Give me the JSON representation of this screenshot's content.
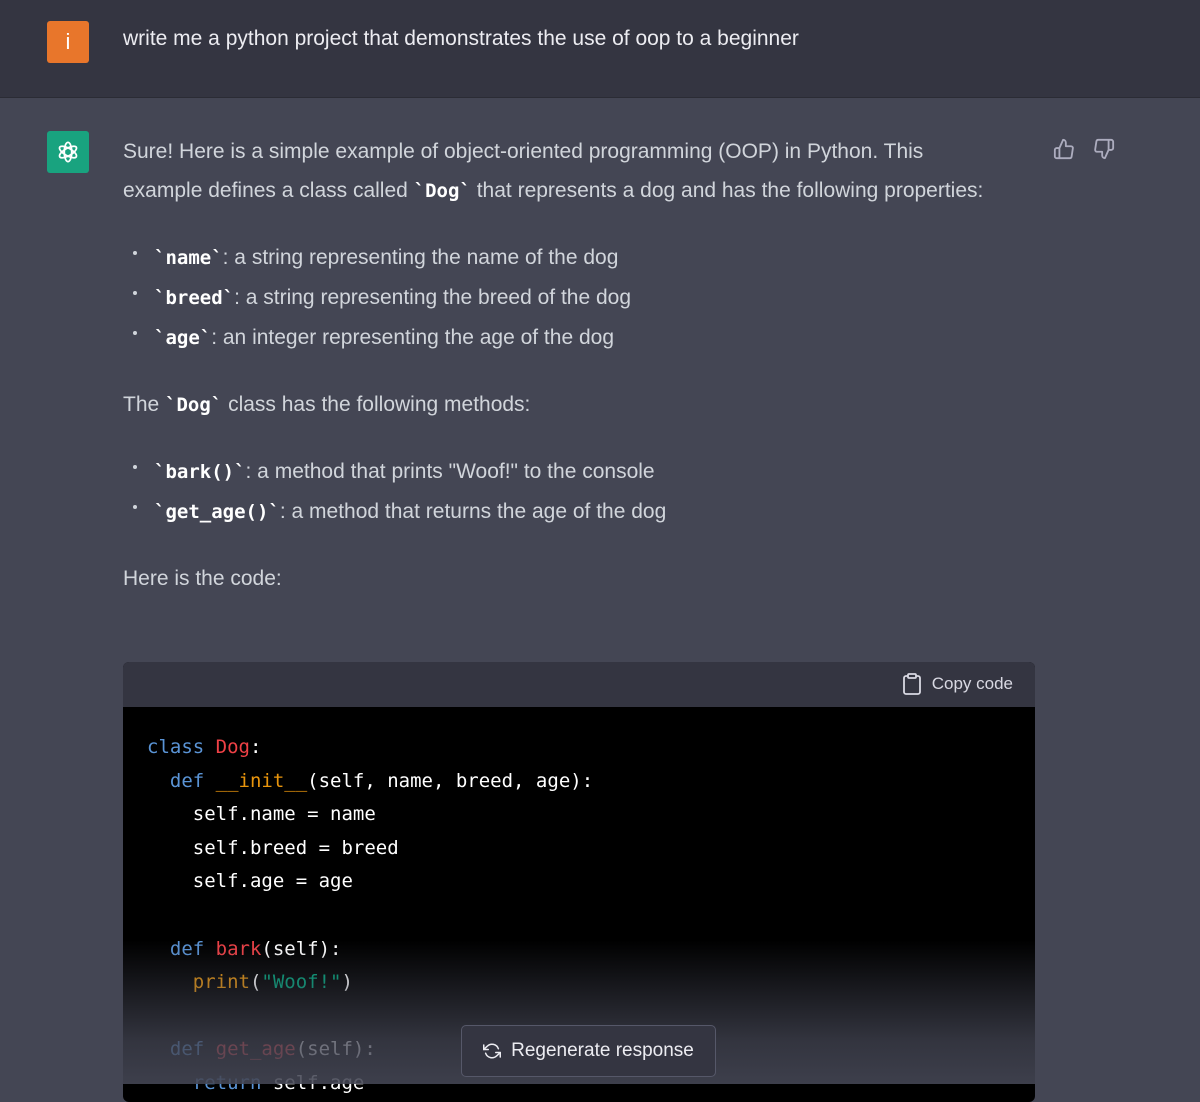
{
  "user_message": {
    "avatar_letter": "i",
    "text": "write me a python project that demonstrates the use of oop to a beginner"
  },
  "assistant_message": {
    "intro_1": "Sure! Here is a simple example of object-oriented programming (OOP) in Python. This example defines a class called ",
    "intro_code": "`Dog`",
    "intro_2": " that represents a dog and has the following properties:",
    "properties": [
      {
        "code": "`name`",
        "text": ": a string representing the name of the dog"
      },
      {
        "code": "`breed`",
        "text": ": a string representing the breed of the dog"
      },
      {
        "code": "`age`",
        "text": ": an integer representing the age of the dog"
      }
    ],
    "methods_intro_1": "The ",
    "methods_intro_code": "`Dog`",
    "methods_intro_2": " class has the following methods:",
    "methods": [
      {
        "code": "`bark()`",
        "text": ": a method that prints \"Woof!\" to the console"
      },
      {
        "code": "`get_age()`",
        "text": ": a method that returns the age of the dog"
      }
    ],
    "code_intro": "Here is the code:"
  },
  "code_block": {
    "copy_label": "Copy code",
    "lines": [
      [
        {
          "t": "class ",
          "c": "kw"
        },
        {
          "t": "Dog",
          "c": "cls"
        },
        {
          "t": ":",
          "c": ""
        }
      ],
      [
        {
          "t": "  def ",
          "c": "kw"
        },
        {
          "t": "__init__",
          "c": "bi"
        },
        {
          "t": "(self, name, breed, age):",
          "c": ""
        }
      ],
      [
        {
          "t": "    self.name = name",
          "c": ""
        }
      ],
      [
        {
          "t": "    self.breed = breed",
          "c": ""
        }
      ],
      [
        {
          "t": "    self.age = age",
          "c": ""
        }
      ],
      [
        {
          "t": "",
          "c": ""
        }
      ],
      [
        {
          "t": "  def ",
          "c": "kw"
        },
        {
          "t": "bark",
          "c": "fn"
        },
        {
          "t": "(self):",
          "c": ""
        }
      ],
      [
        {
          "t": "    ",
          "c": ""
        },
        {
          "t": "print",
          "c": "bi"
        },
        {
          "t": "(",
          "c": ""
        },
        {
          "t": "\"Woof!\"",
          "c": "str"
        },
        {
          "t": ")",
          "c": ""
        }
      ],
      [
        {
          "t": "",
          "c": ""
        }
      ],
      [
        {
          "t": "  def ",
          "c": "kw"
        },
        {
          "t": "get_age",
          "c": "fn"
        },
        {
          "t": "(self):",
          "c": ""
        }
      ],
      [
        {
          "t": "    ",
          "c": ""
        },
        {
          "t": "return",
          "c": "kw"
        },
        {
          "t": " self.age",
          "c": ""
        }
      ]
    ]
  },
  "regenerate_label": "Regenerate response",
  "icons": {
    "thumbs_up": "thumbs-up-icon",
    "thumbs_down": "thumbs-down-icon",
    "clipboard": "clipboard-icon",
    "regenerate": "refresh-icon",
    "assistant_logo": "openai-logo-icon"
  },
  "colors": {
    "user_bg": "#343541",
    "assistant_bg": "#444654",
    "user_avatar": "#e8762b",
    "assistant_avatar": "#19a37f"
  }
}
